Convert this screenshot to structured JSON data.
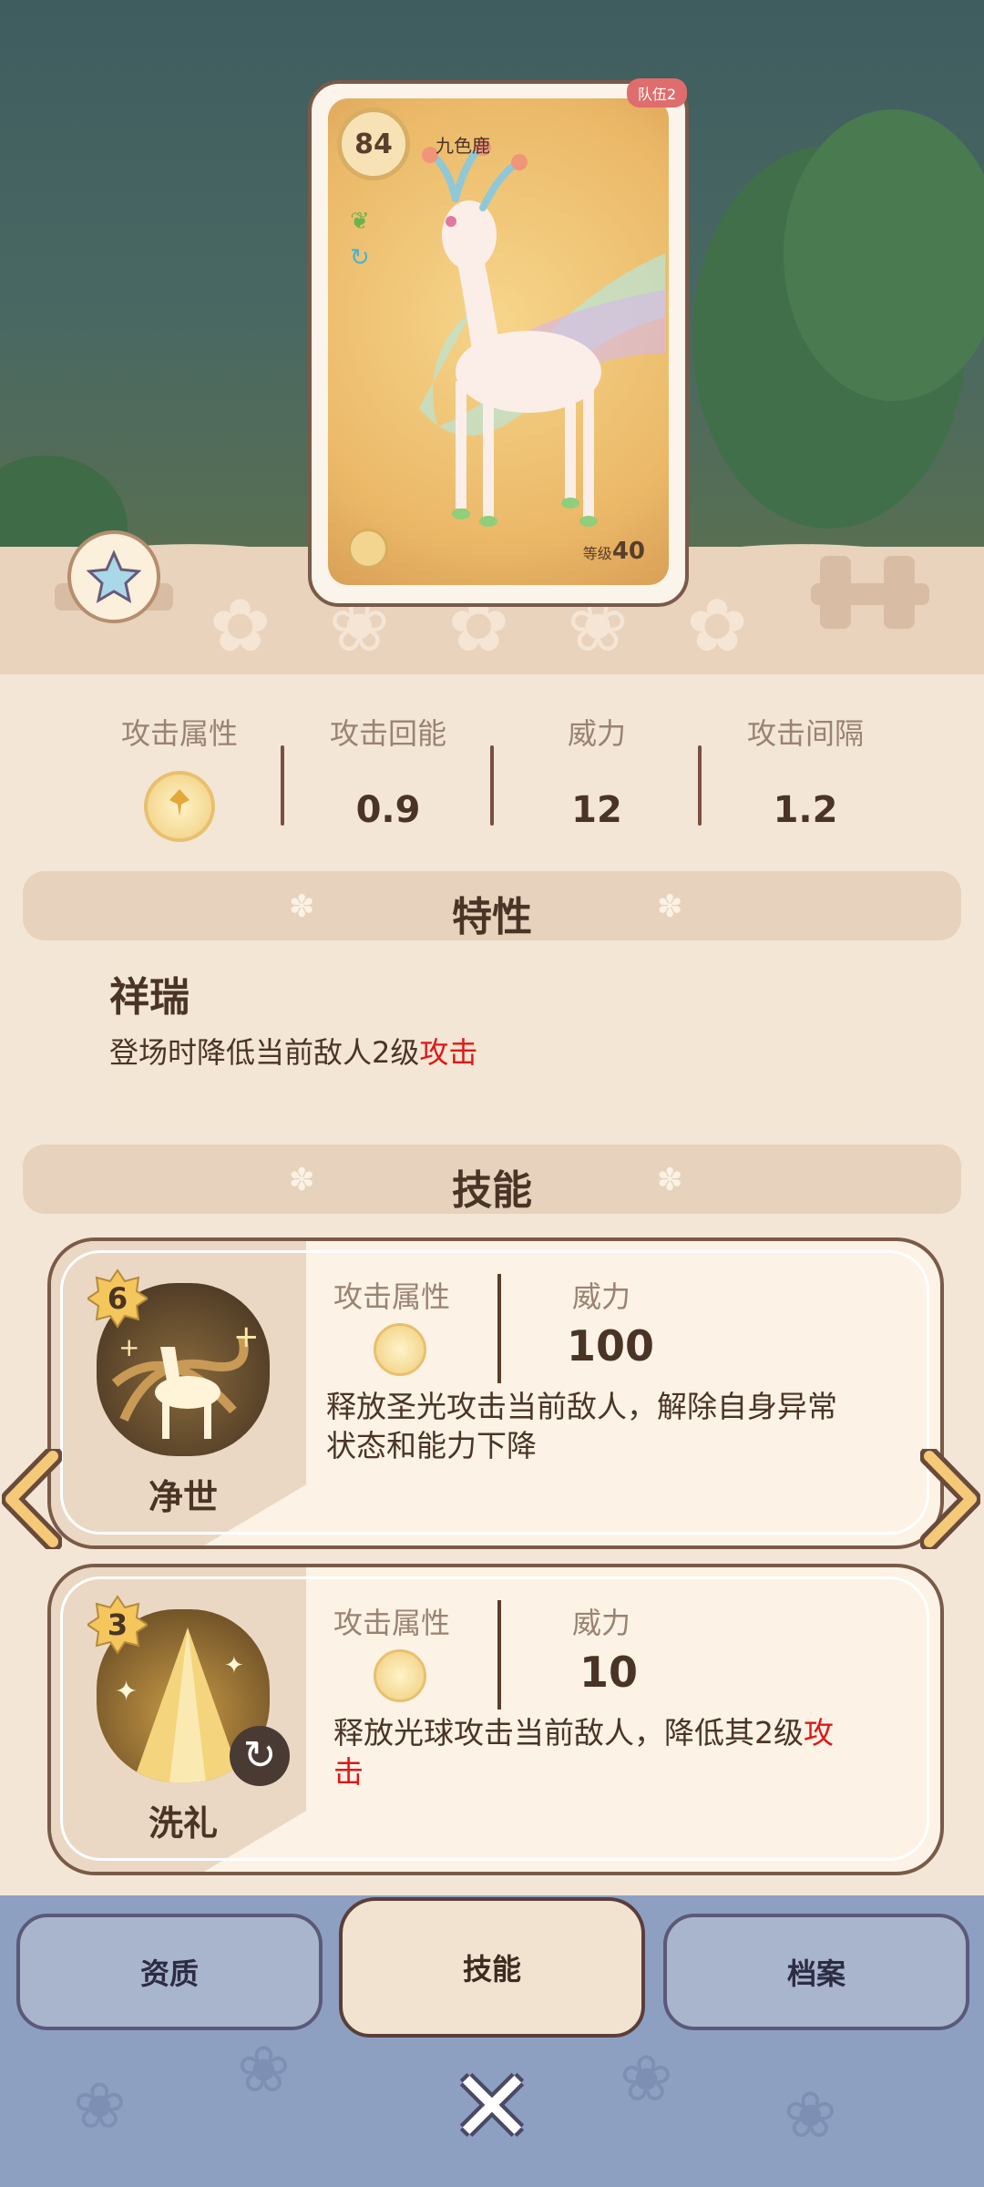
{
  "card": {
    "level": "84",
    "name": "九色鹿",
    "team_tag": "队伍2",
    "lv_label": "等级",
    "lv_value": "40"
  },
  "stats": [
    {
      "label": "攻击属性",
      "value": "",
      "icon": "light-element-icon"
    },
    {
      "label": "攻击回能",
      "value": "0.9"
    },
    {
      "label": "威力",
      "value": "12"
    },
    {
      "label": "攻击间隔",
      "value": "1.2"
    }
  ],
  "trait_section": {
    "title": "特性"
  },
  "trait": {
    "name": "祥瑞",
    "desc_prefix": "登场时降低当前敌人2级",
    "desc_highlight": "攻击"
  },
  "skill_section": {
    "title": "技能"
  },
  "skills": [
    {
      "cost": "6",
      "name": "净世",
      "attr_label": "攻击属性",
      "power_label": "威力",
      "power": "100",
      "desc_line1": "释放圣光攻击当前敌人，解除自身异常",
      "desc_line2": "状态和能力下降"
    },
    {
      "cost": "3",
      "name": "洗礼",
      "attr_label": "攻击属性",
      "power_label": "威力",
      "power": "10",
      "desc_line1_prefix": "释放光球攻击当前敌人，降低其2级",
      "desc_line1_highlight": "攻",
      "desc_line2_highlight": "击"
    }
  ],
  "tabs": [
    {
      "label": "资质"
    },
    {
      "label": "技能",
      "active": true
    },
    {
      "label": "档案"
    }
  ],
  "colors": {
    "highlight": "#e01818",
    "accent_gold": "#e8c06e",
    "bottom_bg": "#8da0c2"
  }
}
